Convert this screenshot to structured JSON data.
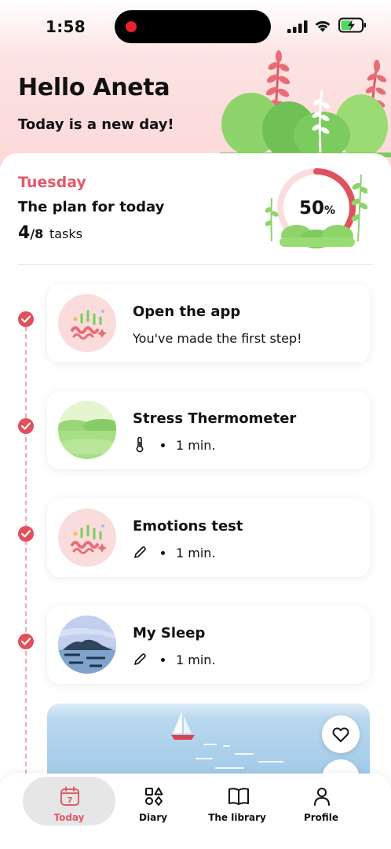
{
  "status_bar": {
    "time": "1:58"
  },
  "header": {
    "greeting": "Hello Aneta",
    "subtitle": "Today is a new day!"
  },
  "plan": {
    "day": "Tuesday",
    "title": "The plan for today",
    "completed": "4",
    "total": "/8",
    "tasks_word": "tasks",
    "progress_value": "50",
    "progress_unit": "%",
    "progress_fraction": 0.5
  },
  "tasks": [
    {
      "title": "Open the app",
      "description": "You've made the first step!",
      "icon": "sparkle-illustration",
      "done": true
    },
    {
      "title": "Stress Thermometer",
      "meta_icon": "thermometer-icon",
      "duration": "1 min.",
      "icon": "meadow-illustration",
      "done": true
    },
    {
      "title": "Emotions test",
      "meta_icon": "pencil-icon",
      "duration": "1 min.",
      "icon": "sparkle-illustration",
      "done": true
    },
    {
      "title": "My Sleep",
      "meta_icon": "pencil-icon",
      "duration": "1 min.",
      "icon": "night-island-illustration",
      "done": true
    }
  ],
  "tabbar": {
    "items": [
      {
        "label": "Today",
        "icon": "calendar-icon",
        "badge": "7",
        "active": true
      },
      {
        "label": "Diary",
        "icon": "shapes-icon",
        "active": false
      },
      {
        "label": "The library",
        "icon": "book-icon",
        "active": false
      },
      {
        "label": "Profile",
        "icon": "person-icon",
        "active": false
      }
    ]
  },
  "colors": {
    "accent": "#e05a6a",
    "header_bg": "#fbd6d6",
    "check": "#e0505d"
  }
}
